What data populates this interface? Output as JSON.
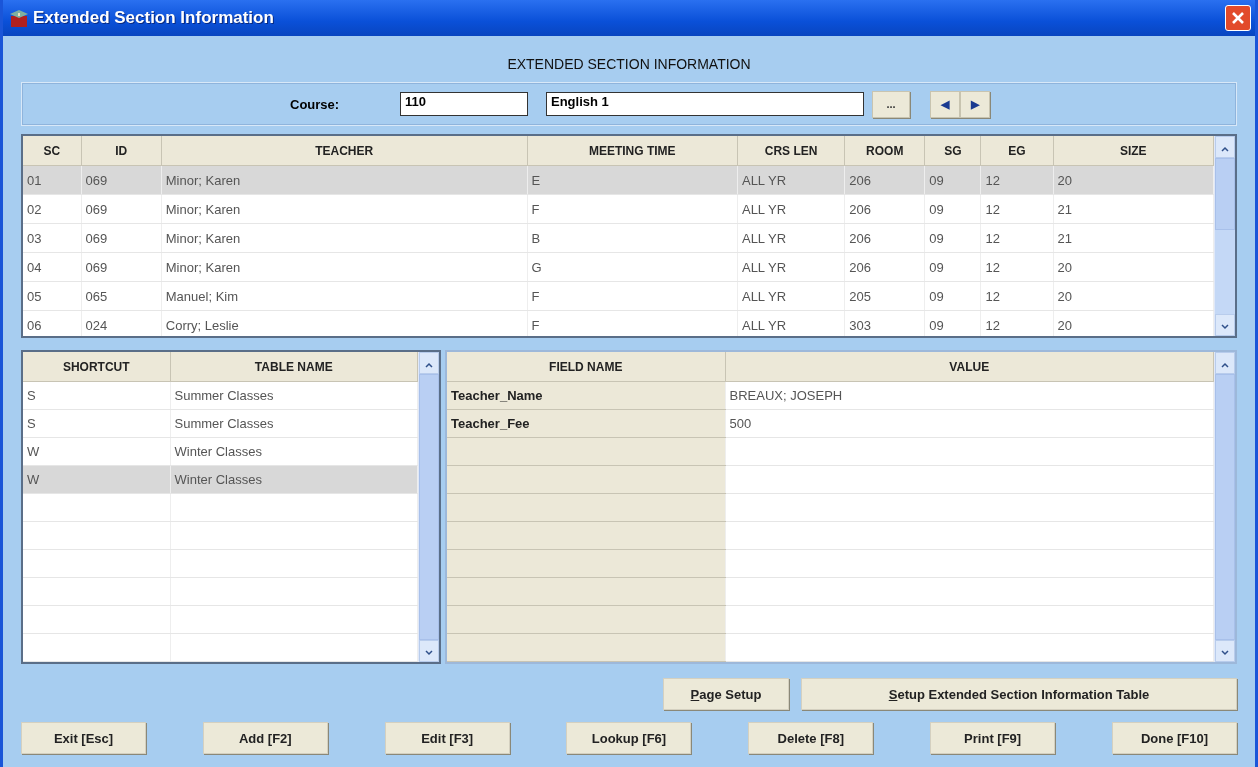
{
  "window": {
    "title": "Extended Section Information"
  },
  "heading": "EXTENDED SECTION INFORMATION",
  "course": {
    "label": "Course:",
    "code": "110",
    "name": "English 1",
    "browse_button": "...",
    "prev_button": "◀",
    "next_button": "▶"
  },
  "sections": {
    "columns": [
      "SC",
      "ID",
      "TEACHER",
      "MEETING TIME",
      "CRS LEN",
      "ROOM",
      "SG",
      "EG",
      "SIZE"
    ],
    "rows": [
      {
        "cells": [
          "01",
          "069",
          "Minor; Karen",
          "E",
          "ALL YR",
          "206",
          "09",
          "12",
          "20"
        ],
        "selected": true
      },
      {
        "cells": [
          "02",
          "069",
          "Minor; Karen",
          "F",
          "ALL YR",
          "206",
          "09",
          "12",
          "21"
        ],
        "selected": false
      },
      {
        "cells": [
          "03",
          "069",
          "Minor; Karen",
          "B",
          "ALL YR",
          "206",
          "09",
          "12",
          "21"
        ],
        "selected": false
      },
      {
        "cells": [
          "04",
          "069",
          "Minor; Karen",
          "G",
          "ALL YR",
          "206",
          "09",
          "12",
          "20"
        ],
        "selected": false
      },
      {
        "cells": [
          "05",
          "065",
          "Manuel; Kim",
          "F",
          "ALL YR",
          "205",
          "09",
          "12",
          "20"
        ],
        "selected": false
      },
      {
        "cells": [
          "06",
          "024",
          "Corry; Leslie",
          "F",
          "ALL YR",
          "303",
          "09",
          "12",
          "20"
        ],
        "selected": false
      }
    ]
  },
  "tables": {
    "columns": [
      "SHORTCUT",
      "TABLE NAME"
    ],
    "rows": [
      {
        "shortcut": "S",
        "table_name": "Summer Classes",
        "selected": false
      },
      {
        "shortcut": "S",
        "table_name": "Summer Classes",
        "selected": false
      },
      {
        "shortcut": "W",
        "table_name": "Winter Classes",
        "selected": false
      },
      {
        "shortcut": "W",
        "table_name": "Winter Classes",
        "selected": true
      }
    ]
  },
  "fields": {
    "columns": [
      "FIELD NAME",
      "VALUE"
    ],
    "rows": [
      {
        "field_name": "Teacher_Name",
        "value": "BREAUX; JOSEPH"
      },
      {
        "field_name": "Teacher_Fee",
        "value": "500"
      }
    ]
  },
  "setup_buttons": [
    {
      "label": "Page Setup",
      "access_key_underlined": true
    },
    {
      "label": "Setup Extended Section Information Table",
      "access_key_underlined": true
    }
  ],
  "buttons": [
    "Exit [Esc]",
    "Add [F2]",
    "Edit [F3]",
    "Lookup [F6]",
    "Delete [F8]",
    "Print [F9]",
    "Done [F10]"
  ]
}
